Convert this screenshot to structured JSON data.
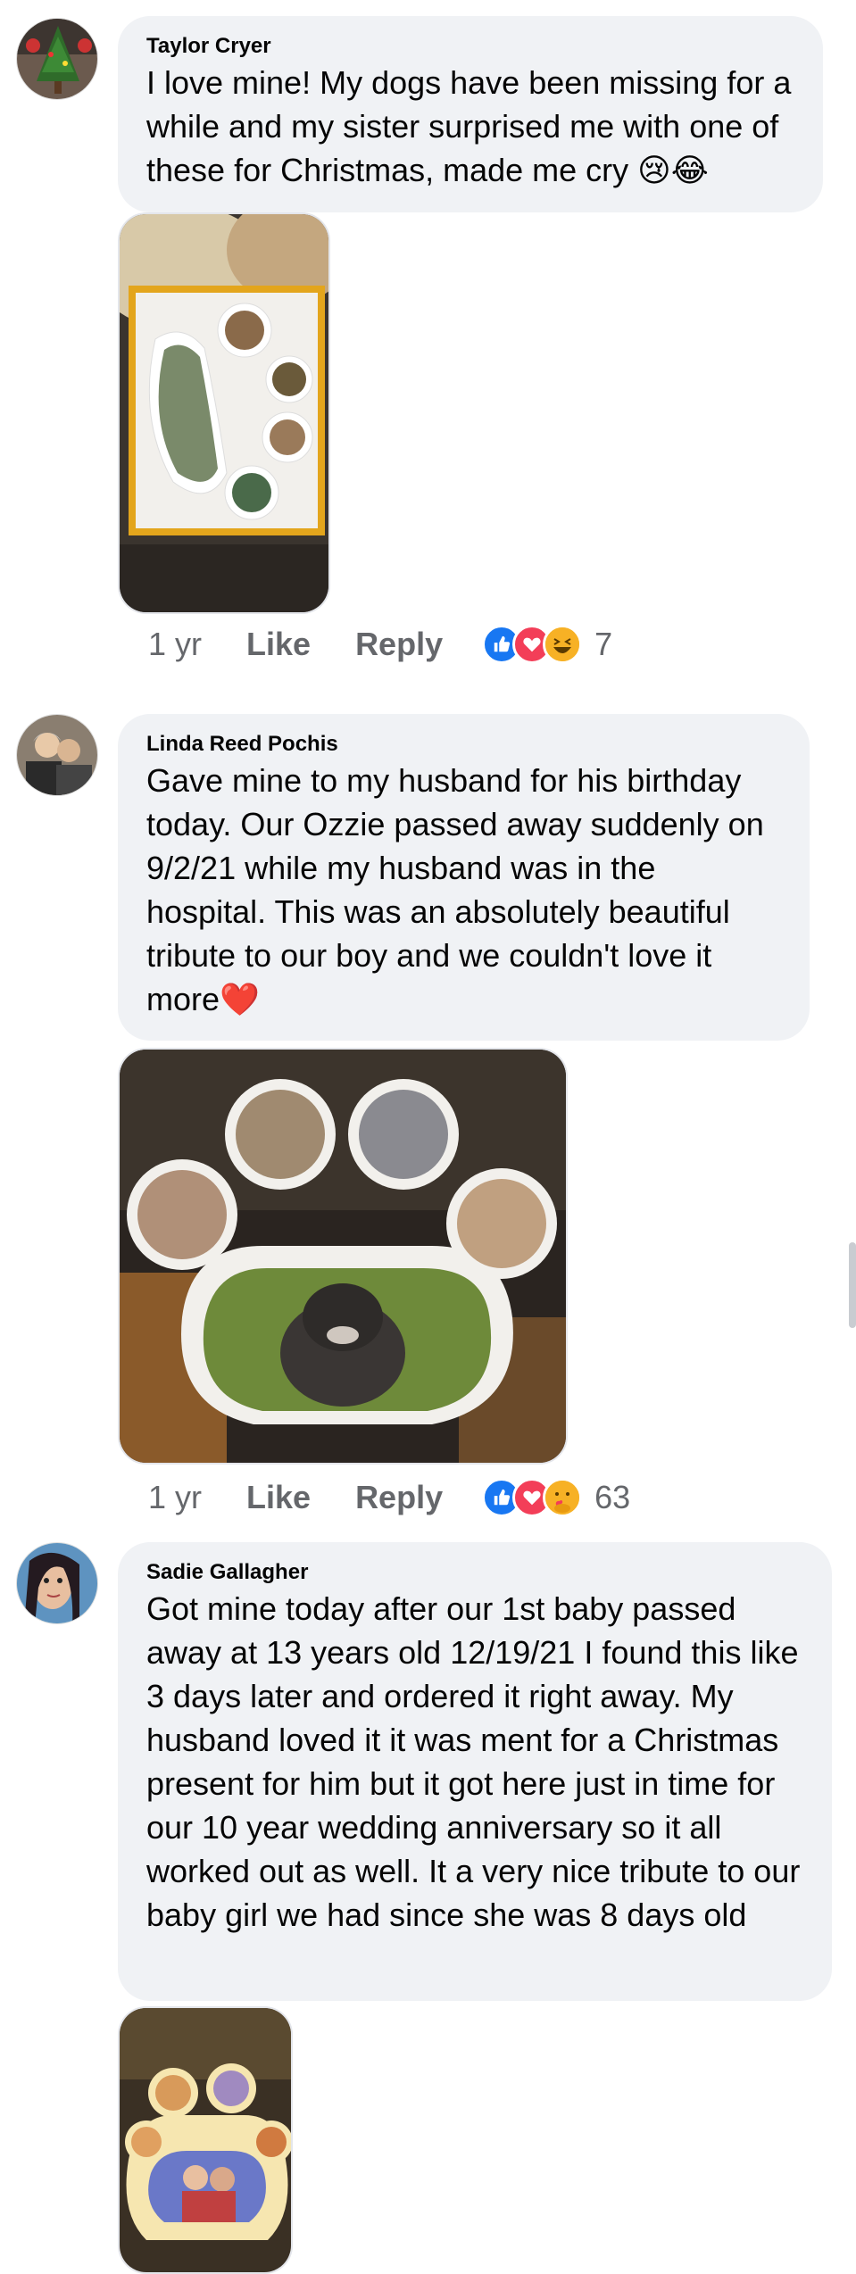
{
  "comments": [
    {
      "author": "Taylor Cryer",
      "text": "I love mine! My dogs have been missing for a while and my sister surprised me with one of these for Christmas, made me cry 😢😂",
      "time": "1 yr",
      "like_label": "Like",
      "reply_label": "Reply",
      "reactions": [
        "like-icon",
        "love-icon",
        "haha-icon"
      ],
      "reaction_count": "7"
    },
    {
      "author": "Linda Reed Pochis",
      "text": "Gave mine to my husband for his birthday today. Our Ozzie passed away suddenly on 9/2/21 while my husband was in the hospital. This was an absolutely beautiful tribute to our boy and we couldn't love it more❤️",
      "time": "1 yr",
      "like_label": "Like",
      "reply_label": "Reply",
      "reactions": [
        "like-icon",
        "love-icon",
        "care-icon"
      ],
      "reaction_count": "63"
    },
    {
      "author": "Sadie Gallagher",
      "text": "Got mine today after our 1st baby passed away at 13 years old 12/19/21 I found this like 3 days later and ordered it right away. My husband loved it it was ment for a Christmas present for him but it got here just in time for our 10 year wedding anniversary so it all worked out as well. It a very nice tribute to our baby girl we had since she was 8 days old"
    }
  ],
  "colors": {
    "bubble": "#f0f2f5",
    "meta_text": "#65676b",
    "like_blue": "#1877f2",
    "love_red": "#f33e58",
    "haha_yellow": "#f7b125"
  }
}
